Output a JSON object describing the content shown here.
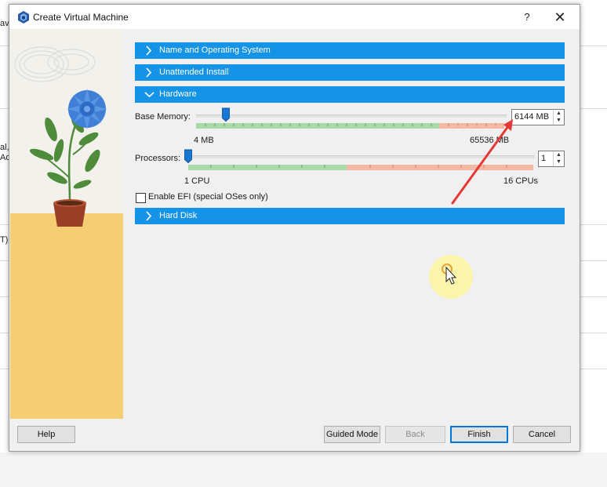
{
  "window": {
    "title": "Create Virtual Machine",
    "help_glyph": "?",
    "close_glyph": "✕"
  },
  "background": {
    "fragments": [
      "avir",
      "al,",
      "Ad",
      "T)"
    ]
  },
  "sections": [
    {
      "label": "Name and Operating System",
      "expanded": false
    },
    {
      "label": "Unattended Install",
      "expanded": false
    },
    {
      "label": "Hardware",
      "expanded": true
    },
    {
      "label": "Hard Disk",
      "expanded": false
    }
  ],
  "hardware": {
    "base_memory": {
      "label": "Base Memory:",
      "value": "6144 MB",
      "min_label": "4 MB",
      "max_label": "65536 MB",
      "fraction": 0.094
    },
    "processors": {
      "label": "Processors:",
      "value": "1",
      "min_label": "1 CPU",
      "max_label": "16 CPUs",
      "fraction": 0.0
    },
    "efi": {
      "label": "Enable EFI (special OSes only)",
      "checked": false
    }
  },
  "buttons": {
    "help": "Help",
    "guided_mode": "Guided Mode",
    "back": "Back",
    "finish": "Finish",
    "cancel": "Cancel"
  },
  "colors": {
    "section_bar": "#1593e6",
    "scale_green": "#a8dba8",
    "scale_red": "#f3b9a4",
    "annotation_arrow": "#e53935"
  }
}
